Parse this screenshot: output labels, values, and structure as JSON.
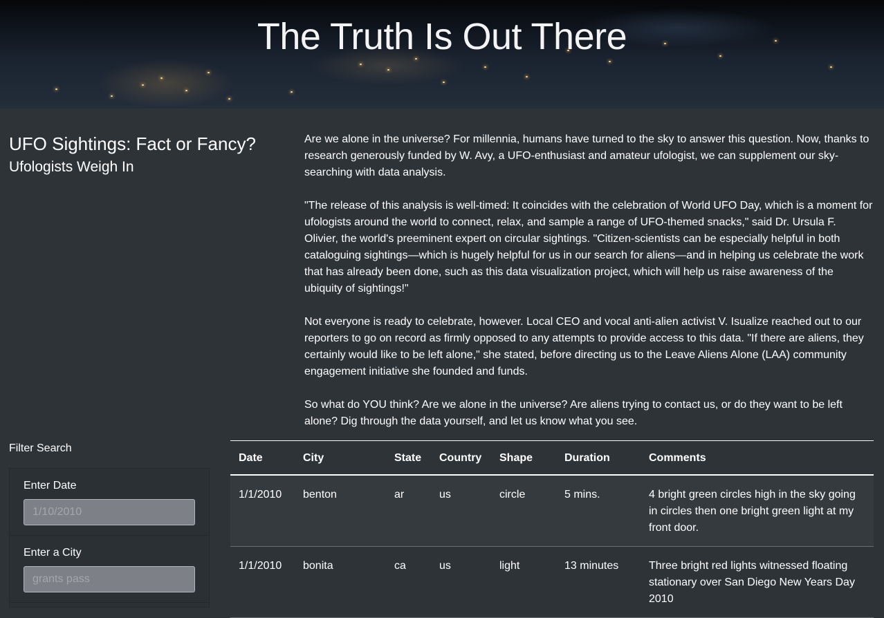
{
  "hero": {
    "title": "The Truth Is Out There"
  },
  "sidebar": {
    "title": "UFO Sightings: Fact or Fancy?",
    "subtitle": "Ufologists Weigh In"
  },
  "article": {
    "paragraphs": [
      "Are we alone in the universe? For millennia, humans have turned to the sky to answer this question. Now, thanks to research generously funded by W. Avy, a UFO-enthusiast and amateur ufologist, we can supplement our sky-searching with data analysis.",
      "\"The release of this analysis is well-timed: It coincides with the celebration of World UFO Day, which is a moment for ufologists around the world to connect, relax, and sample a range of UFO-themed snacks,\" said Dr. Ursula F. Olivier, the world's preeminent expert on circular sightings. \"Citizen-scientists can be especially helpful in both cataloguing sightings—which is hugely helpful for us in our search for aliens—and in helping us celebrate the work that has already been done, such as this data visualization project, which will help us raise awareness of the ubiquity of sightings!\"",
      "Not everyone is ready to celebrate, however. Local CEO and vocal anti-alien activist V. Isualize reached out to our reporters to go on record as firmly opposed to any attempts to provide access to this data. \"If there are aliens, they certainly would like to be left alone,\" she stated, before directing us to the Leave Aliens Alone (LAA) community engagement initiative she founded and funds.",
      "So what do YOU think? Are we alone in the universe? Are aliens trying to contact us, or do they want to be left alone? Dig through the data yourself, and let us know what you see."
    ]
  },
  "filters": {
    "heading": "Filter Search",
    "date": {
      "label": "Enter Date",
      "placeholder": "1/10/2010"
    },
    "city": {
      "label": "Enter a City",
      "placeholder": "grants pass"
    }
  },
  "table": {
    "headers": {
      "date": "Date",
      "city": "City",
      "state": "State",
      "country": "Country",
      "shape": "Shape",
      "duration": "Duration",
      "comments": "Comments"
    },
    "rows": [
      {
        "date": "1/1/2010",
        "city": "benton",
        "state": "ar",
        "country": "us",
        "shape": "circle",
        "duration": "5 mins.",
        "comments": "4 bright green circles high in the sky going in circles then one bright green light at my front door."
      },
      {
        "date": "1/1/2010",
        "city": "bonita",
        "state": "ca",
        "country": "us",
        "shape": "light",
        "duration": "13 minutes",
        "comments": "Three bright red lights witnessed floating stationary over San Diego New Years Day 2010"
      }
    ]
  }
}
